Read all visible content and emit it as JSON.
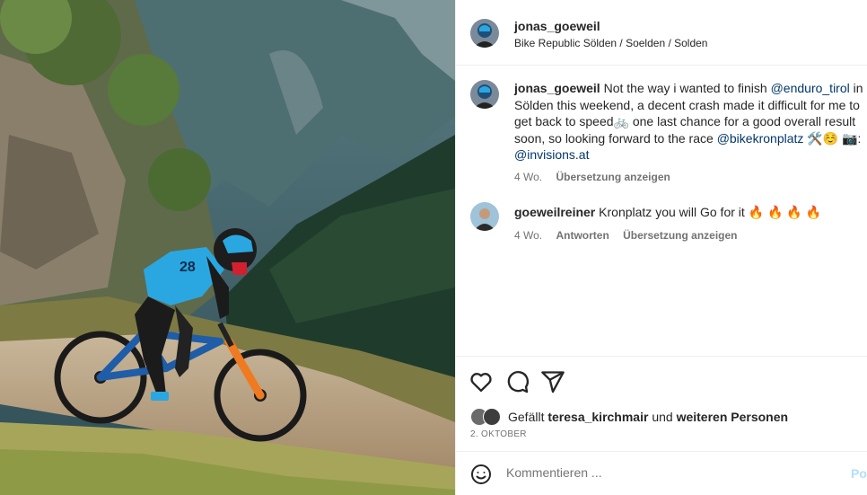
{
  "post": {
    "author": "jonas_goeweil",
    "location": "Bike Republic Sölden / Soelden / Solden"
  },
  "caption": {
    "username": "jonas_goeweil",
    "text_1": "Not the way i wanted to finish ",
    "mention_1": "@enduro_tirol",
    "text_2": " in Sölden this weekend, a decent crash made it difficult for me to get back to speed",
    "emoji_1": "🚲",
    "text_3": " one last chance for a good overall result soon, so looking forward to the race ",
    "mention_2": "@bikekronplatz",
    "emoji_2": " 🛠️☺️ 📷:",
    "mention_3": "@invisions.at",
    "time": "4 Wo.",
    "translate": "Übersetzung anzeigen"
  },
  "comment": {
    "username": "goeweilreiner",
    "text": "Kronplatz you will Go for it",
    "emojis": "🔥 🔥 🔥 🔥",
    "time": "4 Wo.",
    "reply": "Antworten",
    "translate": "Übersetzung anzeigen"
  },
  "likes": {
    "prefix": "Gefällt",
    "user": "teresa_kirchmair",
    "middle": "und",
    "suffix": "weiteren Personen"
  },
  "date": "2. Oktober",
  "compose": {
    "placeholder": "Kommentieren ...",
    "post_label": "Posten"
  },
  "icons": {
    "like": "heart-icon",
    "comment": "comment-icon",
    "share": "send-icon",
    "emoji": "smiley-icon"
  },
  "colors": {
    "mention": "#00376b",
    "meta": "#737373",
    "post_button": "#b2dffc",
    "jersey": "#2aa7e0",
    "fork": "#f07a1f"
  }
}
